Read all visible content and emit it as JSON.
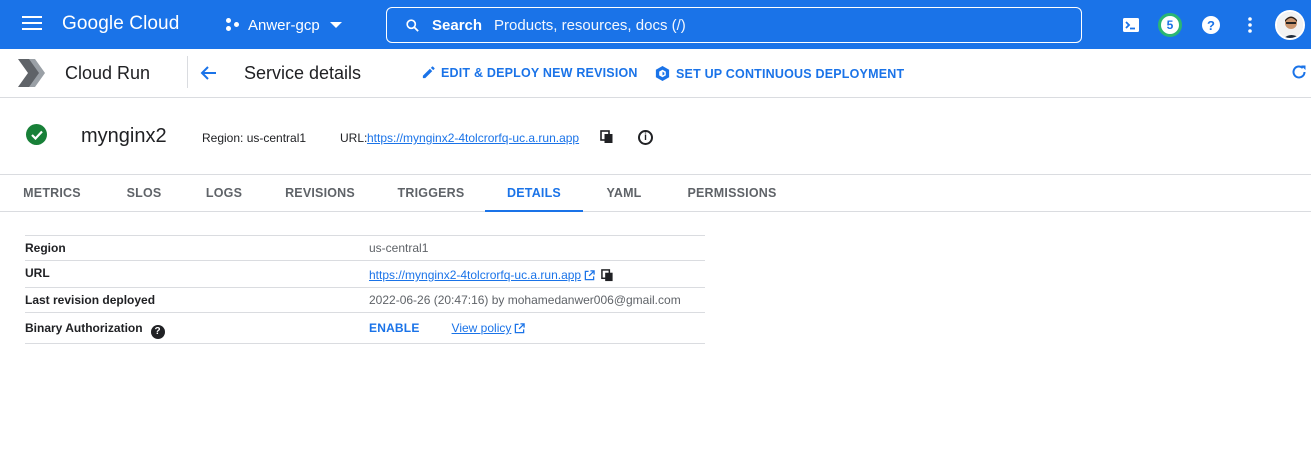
{
  "topbar": {
    "logo_text": "Google Cloud",
    "project": "Anwer-gcp",
    "search_label": "Search",
    "search_placeholder": "Products, resources, docs (/)",
    "notification_count": "5",
    "help_glyph": "?"
  },
  "subheader": {
    "product": "Cloud Run",
    "page_title": "Service details",
    "actions": {
      "edit_deploy": "EDIT & DEPLOY NEW REVISION",
      "continuous_deploy": "SET UP CONTINUOUS DEPLOYMENT"
    }
  },
  "service": {
    "name": "mynginx2",
    "region": "Region: us-central1",
    "url_label": "URL:",
    "url": "https://mynginx2-4tolcrorfq-uc.a.run.app",
    "status_color": "#188038"
  },
  "tabs": [
    {
      "label": "METRICS"
    },
    {
      "label": "SLOS"
    },
    {
      "label": "LOGS"
    },
    {
      "label": "REVISIONS"
    },
    {
      "label": "TRIGGERS"
    },
    {
      "label": "DETAILS"
    },
    {
      "label": "YAML"
    },
    {
      "label": "PERMISSIONS"
    }
  ],
  "active_tab": "DETAILS",
  "details": {
    "region_label": "Region",
    "region_value": "us-central1",
    "url_label": "URL",
    "url_value": "https://mynginx2-4tolcrorfq-uc.a.run.app",
    "last_rev_label": "Last revision deployed",
    "last_rev_value": "2022-06-26 (20:47:16) by mohamedanwer006@gmail.com",
    "binauth_label": "Binary Authorization",
    "enable_label": "ENABLE",
    "view_policy_label": "View policy"
  },
  "colors": {
    "brand_blue": "#1a73e8",
    "success_green": "#188038",
    "badge_ring": "#2bb673"
  }
}
